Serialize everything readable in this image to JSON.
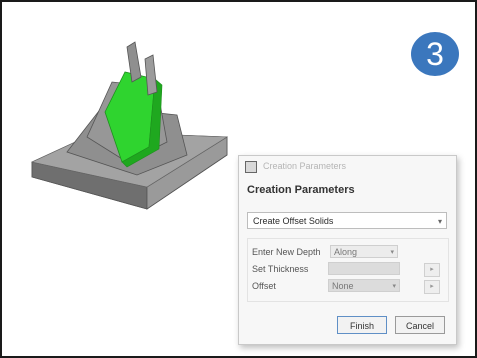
{
  "step_number": "3",
  "model_icon": "3d-part-model-icon",
  "dialog": {
    "app_icon": "window-app-icon",
    "title": "Creation Parameters",
    "heading": "Creation Parameters",
    "mode_select": {
      "value": "Create Offset Solids",
      "arrow_icon": "chevron-down-icon"
    },
    "fields": {
      "enter_new_depth": {
        "label": "Enter New Depth",
        "value": "Along"
      },
      "thickness": {
        "label": "Set Thickness",
        "value": ""
      },
      "offset": {
        "label": "Offset",
        "value": "None"
      }
    },
    "buttons": {
      "finish": "Finish",
      "cancel": "Cancel"
    }
  },
  "colors": {
    "badge": "#3b77bd",
    "model_gray": "#8c8c8c",
    "highlight_green": "#2fd42f"
  }
}
